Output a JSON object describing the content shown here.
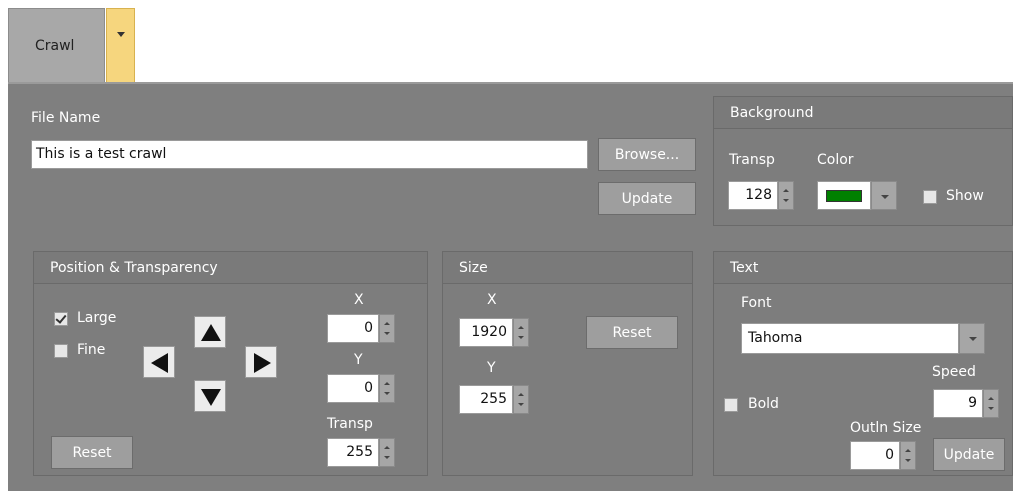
{
  "tab": {
    "label": "Crawl"
  },
  "file": {
    "label": "File Name",
    "value": "This is a test crawl",
    "browse_label": "Browse...",
    "update_label": "Update"
  },
  "background": {
    "title": "Background",
    "transp_label": "Transp",
    "transp_value": "128",
    "color_label": "Color",
    "color_value": "#008000",
    "show_label": "Show",
    "show_checked": false
  },
  "position": {
    "title": "Position & Transparency",
    "large_label": "Large",
    "large_checked": true,
    "fine_label": "Fine",
    "fine_checked": false,
    "x_label": "X",
    "x_value": "0",
    "y_label": "Y",
    "y_value": "0",
    "transp_label": "Transp",
    "transp_value": "255",
    "reset_label": "Reset"
  },
  "size": {
    "title": "Size",
    "x_label": "X",
    "x_value": "1920",
    "y_label": "Y",
    "y_value": "255",
    "reset_label": "Reset"
  },
  "text": {
    "title": "Text",
    "font_label": "Font",
    "font_value": "Tahoma",
    "speed_label": "Speed",
    "speed_value": "9",
    "bold_label": "Bold",
    "bold_checked": false,
    "outline_label": "Outln Size",
    "outline_value": "0",
    "update_label": "Update"
  }
}
